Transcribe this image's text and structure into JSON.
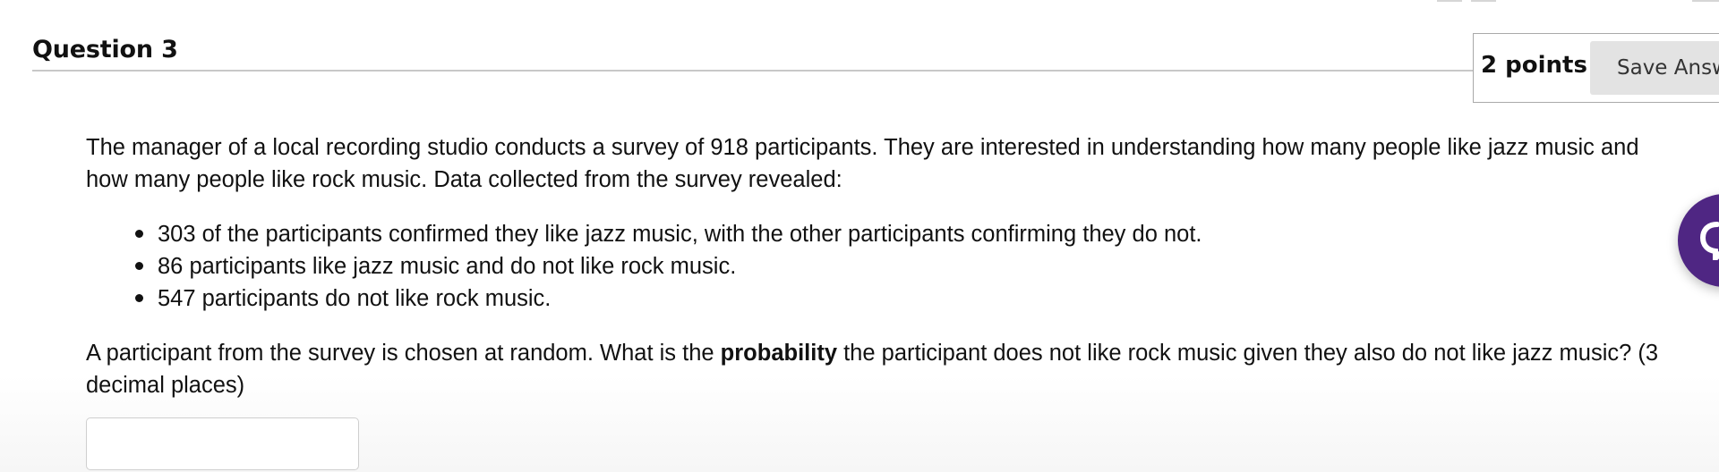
{
  "question": {
    "title": "Question 3",
    "points": "2 points",
    "save_label": "Save Answer"
  },
  "body": {
    "intro": "The manager of a local recording studio conducts a survey of 918 participants. They are interested in understanding how many people like jazz music and how many people like rock music. Data collected from the survey revealed:",
    "bullets": [
      "303 of the participants confirmed they like jazz music, with the other participants confirming they do not.",
      "86 participants like jazz music and do not like rock music.",
      "547 participants do not like rock music."
    ],
    "prompt_before": "A participant from the survey is chosen at random. What is the ",
    "prompt_bold": "probability",
    "prompt_after": " the participant does not like rock music given they also do not like jazz music? (3 decimal places)"
  },
  "answer": {
    "value": "",
    "placeholder": ""
  },
  "help_fab": {
    "icon": "chat-icon",
    "color": "#4f2683"
  }
}
